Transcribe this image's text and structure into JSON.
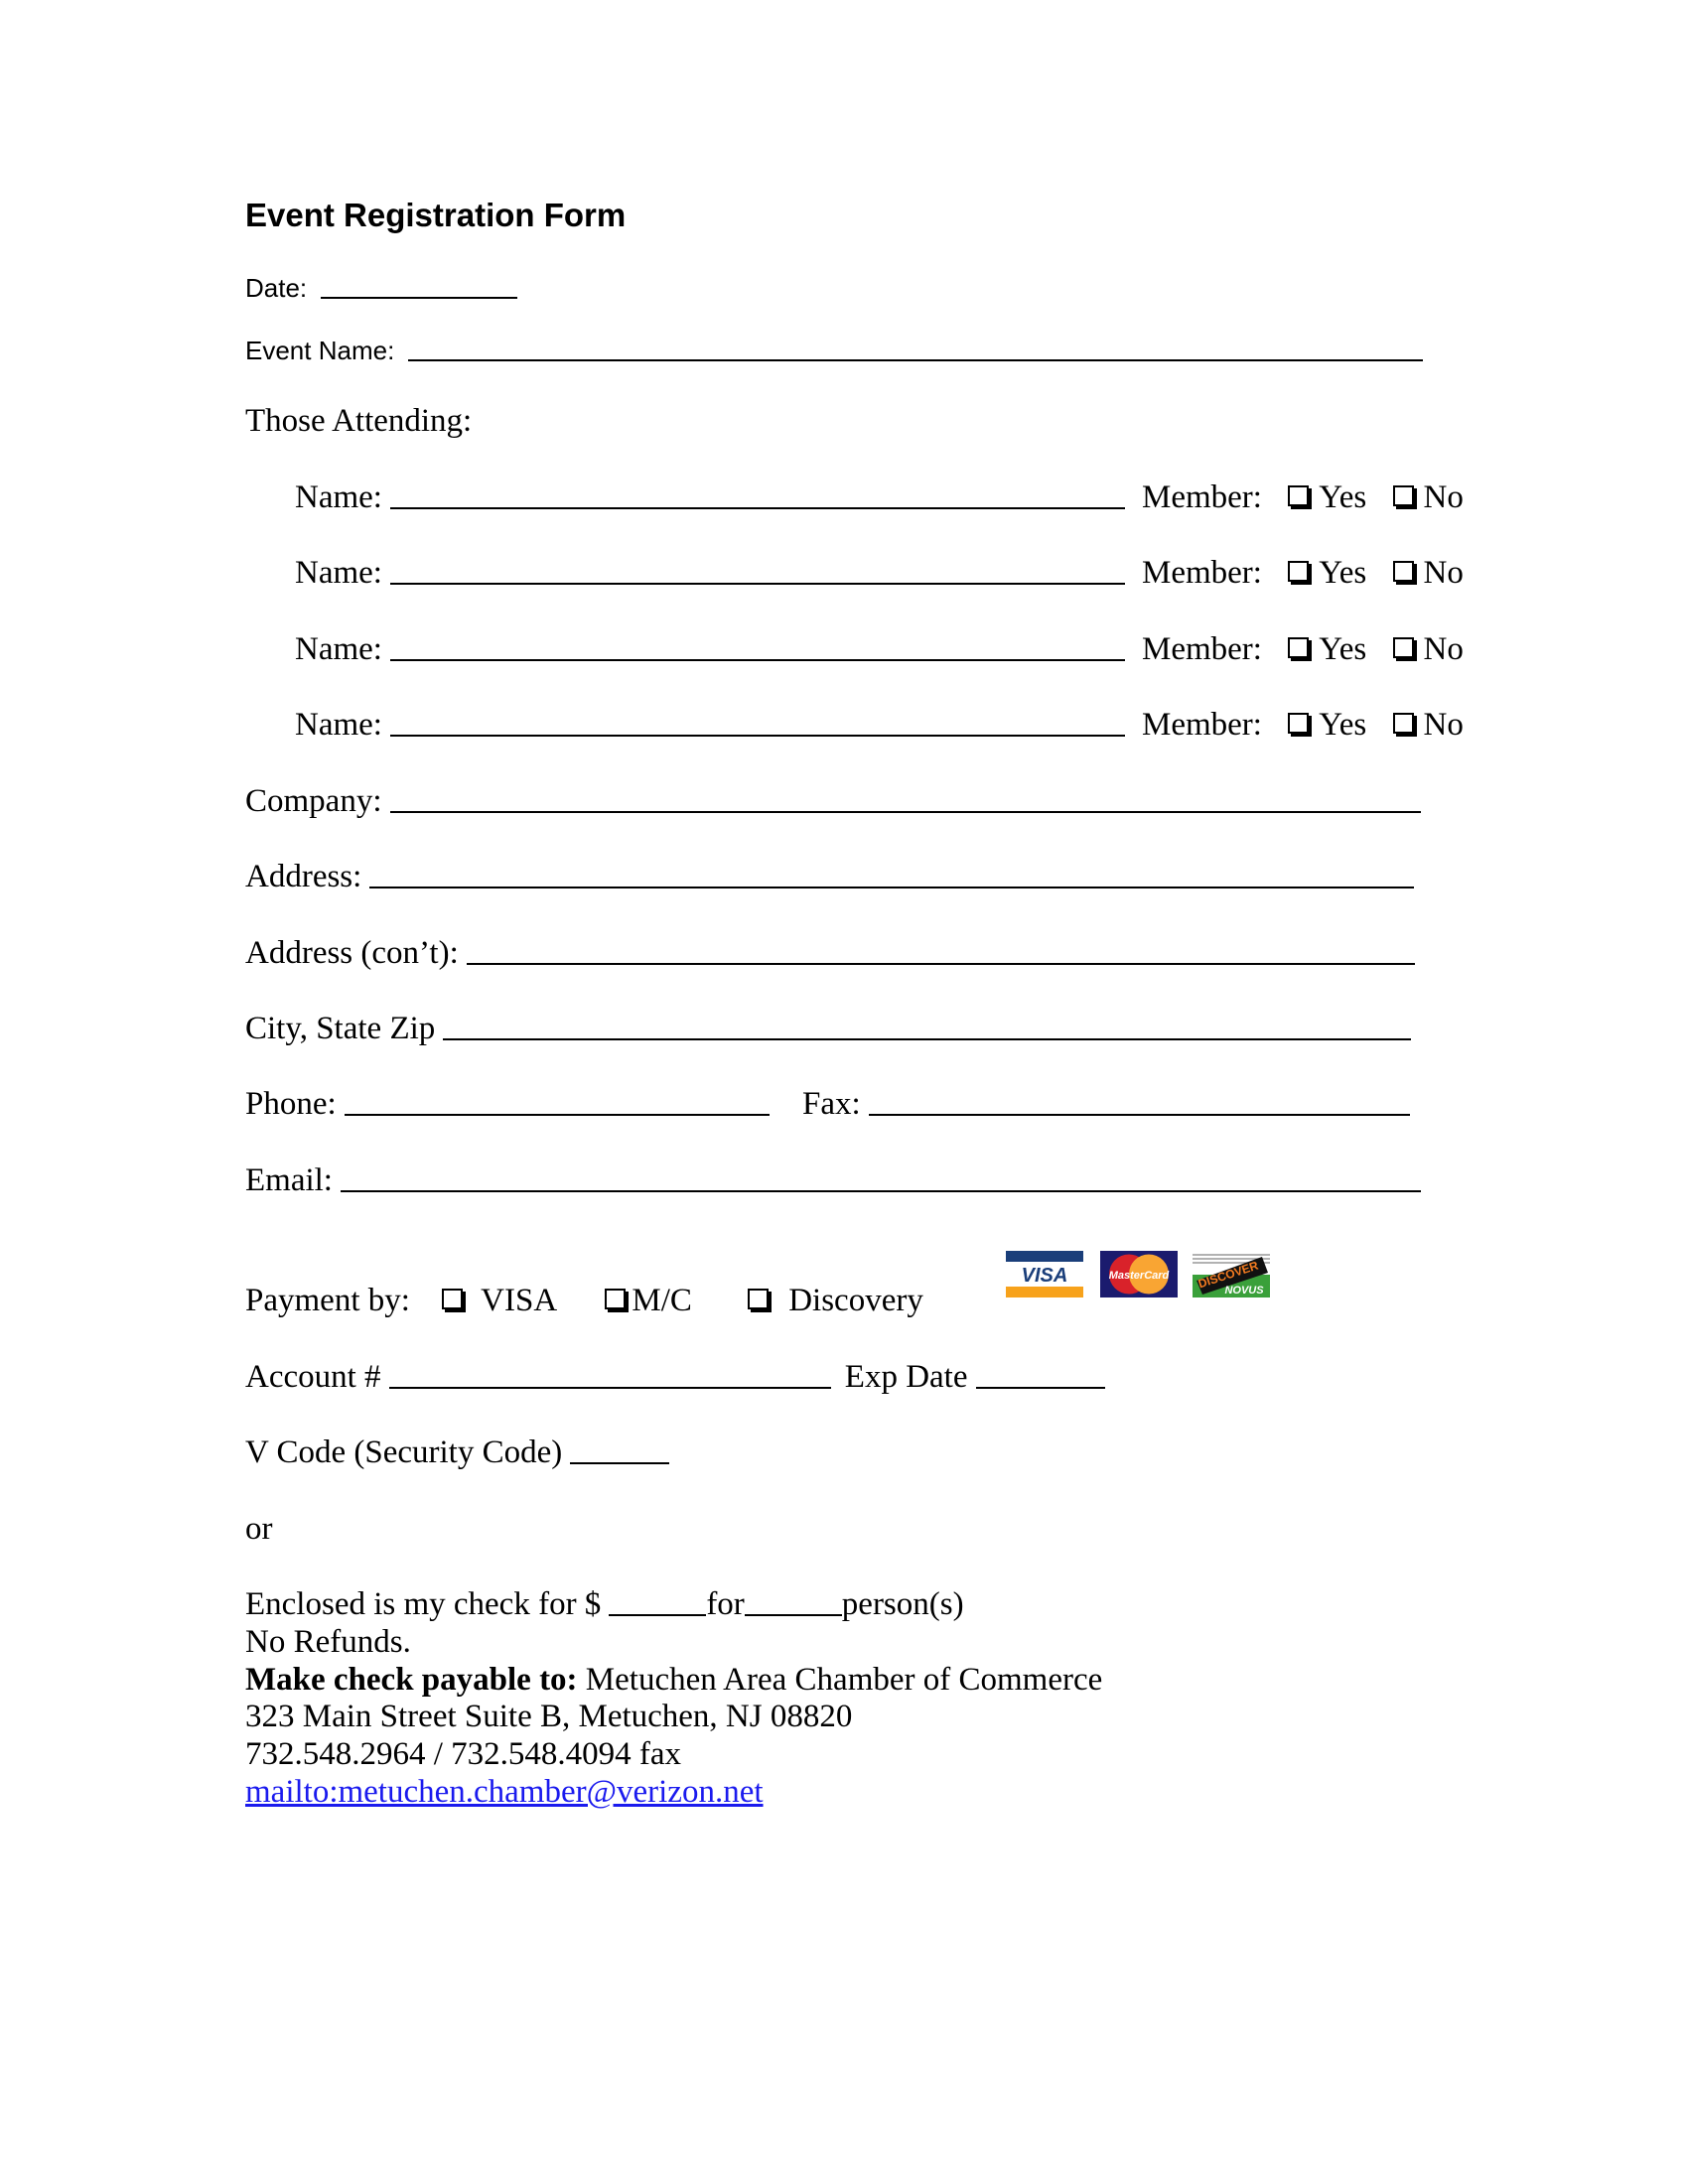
{
  "form": {
    "title": "Event Registration Form",
    "date_label": "Date:",
    "event_name_label": "Event Name:",
    "attending_label": "Those Attending:",
    "attendees": [
      {
        "name_label": "Name:",
        "member_label": "Member:",
        "yes": "Yes",
        "no": "No"
      },
      {
        "name_label": "Name:",
        "member_label": "Member:",
        "yes": "Yes",
        "no": "No"
      },
      {
        "name_label": "Name:",
        "member_label": "Member:",
        "yes": "Yes",
        "no": "No"
      },
      {
        "name_label": "Name:",
        "member_label": "Member:",
        "yes": "Yes",
        "no": "No"
      }
    ],
    "company_label": "Company:",
    "address_label": "Address:",
    "address_cont_label": "Address (con’t):",
    "city_state_zip_label": "City, State Zip",
    "phone_label": "Phone:",
    "fax_label": "Fax:",
    "email_label": "Email:"
  },
  "payment": {
    "label": "Payment by:",
    "options": [
      "VISA",
      "M/C",
      "Discovery"
    ],
    "logos": {
      "visa": {
        "text": "VISA",
        "colors": {
          "blue": "#1a3e7a",
          "gold": "#f7a21b"
        }
      },
      "mastercard": {
        "text": "MasterCard",
        "colors": {
          "red": "#d9222a",
          "orange": "#f9a533",
          "bg": "#1b1b6e"
        }
      },
      "discover": {
        "text_top": "DISCOVER",
        "text_bottom": "NOVUS",
        "colors": {
          "orange": "#f47b20",
          "green": "#3aa03a"
        }
      }
    },
    "account_label": "Account #",
    "exp_label": "Exp Date",
    "vcode_label": "V Code (Security Code)",
    "or_label": "or"
  },
  "check": {
    "enclosed_prefix": "Enclosed is my check for $",
    "for_label": "for",
    "persons_label": "person(s)",
    "no_refunds": "No Refunds.",
    "payable_label": "Make check payable to:",
    "payable_name": "Metuchen Area Chamber of Commerce",
    "address": "323 Main Street Suite B, Metuchen, NJ 08820",
    "phones": "732.548.2964 / 732.548.4094 fax",
    "email_link": "mailto:metuchen.chamber@verizon.net",
    "link_color": "#1a1aee"
  }
}
